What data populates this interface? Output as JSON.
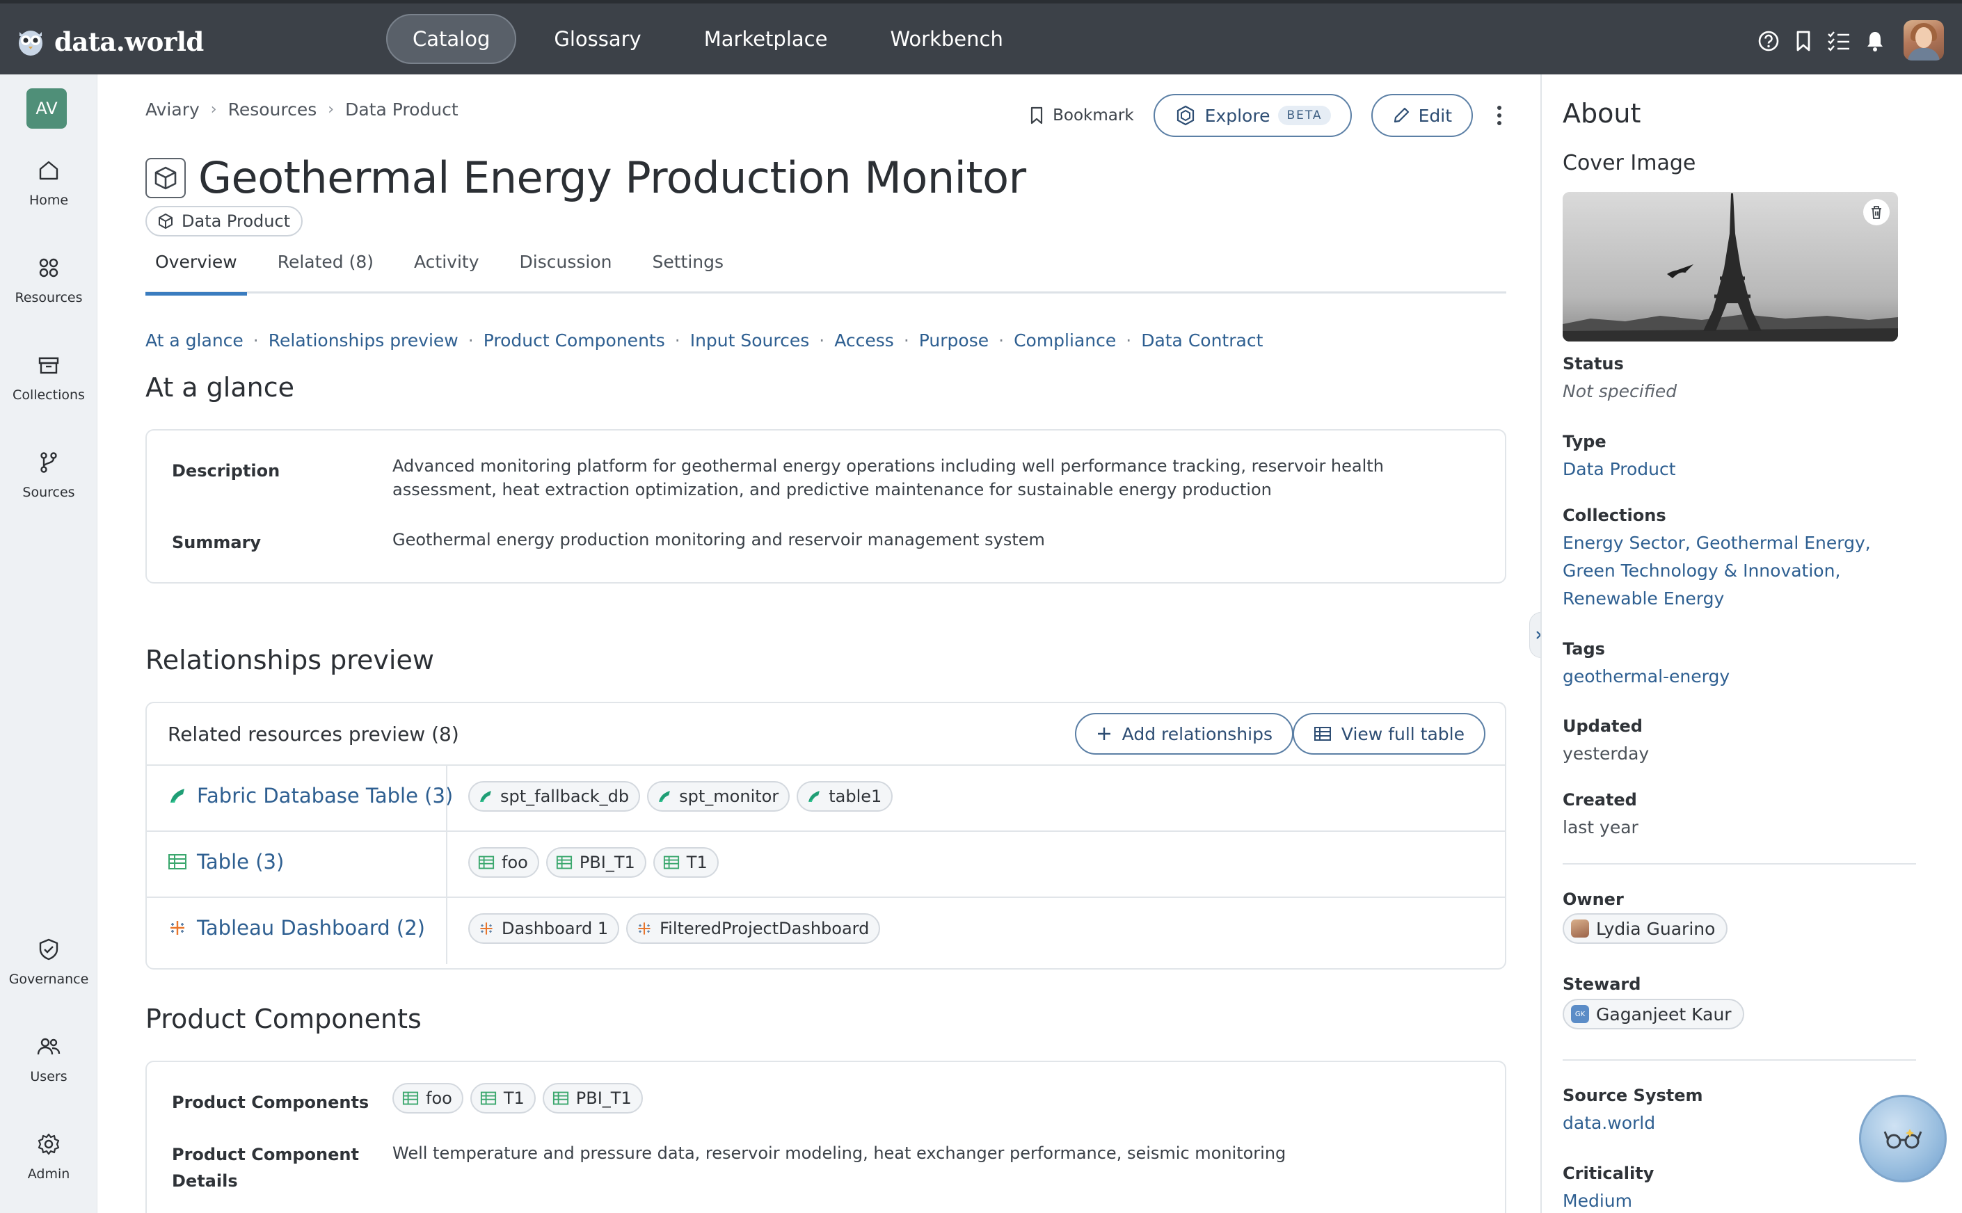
{
  "app": {
    "logo_text": "data.world"
  },
  "nav": {
    "items": [
      "Catalog",
      "Glossary",
      "Marketplace",
      "Workbench"
    ],
    "active": "Catalog"
  },
  "top_icons": [
    "help-icon",
    "bookmark-icon",
    "tasks-icon",
    "bell-icon"
  ],
  "sidebar": {
    "avatar_initials": "AV",
    "items": [
      {
        "label": "Home",
        "icon": "home-icon"
      },
      {
        "label": "Resources",
        "icon": "resources-icon"
      },
      {
        "label": "Collections",
        "icon": "collections-icon"
      },
      {
        "label": "Sources",
        "icon": "sources-icon"
      },
      {
        "label": "Governance",
        "icon": "shield-icon"
      },
      {
        "label": "Users",
        "icon": "users-icon"
      },
      {
        "label": "Admin",
        "icon": "gear-icon"
      }
    ]
  },
  "breadcrumb": [
    "Aviary",
    "Resources",
    "Data Product"
  ],
  "actions": {
    "bookmark": "Bookmark",
    "explore": "Explore",
    "beta": "BETA",
    "edit": "Edit"
  },
  "page": {
    "title": "Geothermal Energy Production Monitor",
    "type": "Data Product"
  },
  "tabs": [
    "Overview",
    "Related (8)",
    "Activity",
    "Discussion",
    "Settings"
  ],
  "anchors": [
    "At a glance",
    "Relationships preview",
    "Product Components",
    "Input Sources",
    "Access",
    "Purpose",
    "Compliance",
    "Data Contract"
  ],
  "glance": {
    "heading": "At a glance",
    "description_label": "Description",
    "description_line1": "Advanced monitoring platform for geothermal energy operations including well performance tracking, reservoir health",
    "description_line2": "assessment, heat extraction optimization, and predictive maintenance for sustainable energy production",
    "summary_label": "Summary",
    "summary": "Geothermal energy production monitoring and reservoir management system"
  },
  "relationships": {
    "heading": "Relationships preview",
    "card_title": "Related resources preview (8)",
    "add_label": "Add relationships",
    "view_label": "View full table",
    "rows": [
      {
        "label": "Fabric Database Table (3)",
        "icon": "fabric-icon",
        "chips": [
          "spt_fallback_db",
          "spt_monitor",
          "table1"
        ]
      },
      {
        "label": "Table (3)",
        "icon": "table-icon",
        "chips": [
          "foo",
          "PBI_T1",
          "T1"
        ]
      },
      {
        "label": "Tableau Dashboard (2)",
        "icon": "tableau-icon",
        "chips": [
          "Dashboard 1",
          "FilteredProjectDashboard"
        ]
      }
    ]
  },
  "components": {
    "heading": "Product Components",
    "label": "Product Components",
    "chips": [
      "foo",
      "T1",
      "PBI_T1"
    ],
    "details_label_1": "Product Component",
    "details_label_2": "Details",
    "details": "Well temperature and pressure data, reservoir modeling, heat exchanger performance, seismic monitoring"
  },
  "about": {
    "heading": "About",
    "cover_label": "Cover Image",
    "status_label": "Status",
    "status": "Not specified",
    "type_label": "Type",
    "type": "Data Product",
    "collections_label": "Collections",
    "collections_line1": "Energy Sector, Geothermal Energy,",
    "collections_line2": "Green Technology & Innovation,",
    "collections_line3": "Renewable Energy",
    "tags_label": "Tags",
    "tags": "geothermal-energy",
    "updated_label": "Updated",
    "updated": "yesterday",
    "created_label": "Created",
    "created": "last year",
    "owner_label": "Owner",
    "owner": "Lydia Guarino",
    "steward_label": "Steward",
    "steward": "Gaganjeet Kaur",
    "steward_initials": "GK",
    "source_label": "Source System",
    "source": "data.world",
    "criticality_label": "Criticality",
    "criticality": "Medium"
  },
  "colors": {
    "topbar": "#3c4148",
    "link": "#2e5f91",
    "accent": "#3a7cbf",
    "sidebar": "#eef1f4"
  }
}
